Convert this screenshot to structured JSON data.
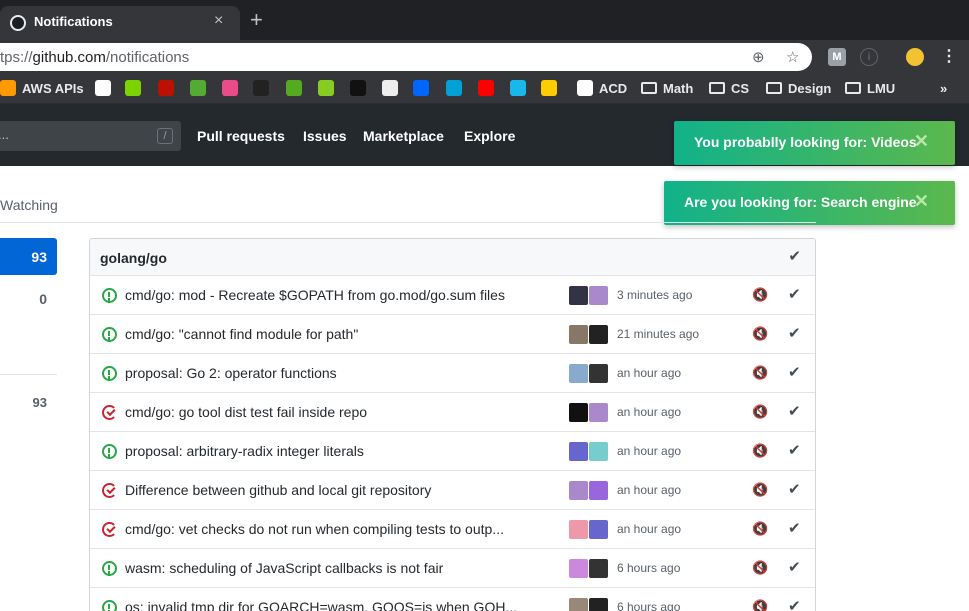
{
  "browser": {
    "tab_title": "Notifications",
    "url_prefix": "tps://",
    "url_host": "github.com",
    "url_path": "/notifications",
    "new_tab": "+",
    "close_tab": "×"
  },
  "bookmarks": [
    {
      "label": "AWS APIs",
      "icon": "aws-icon"
    },
    {
      "label": "",
      "icon": "leetcode-icon"
    },
    {
      "label": "",
      "icon": "smiley-icon"
    },
    {
      "label": "",
      "icon": "as-icon"
    },
    {
      "label": "",
      "icon": "ol-icon"
    },
    {
      "label": "",
      "icon": "dribbble-icon"
    },
    {
      "label": "",
      "icon": "github-dark-icon"
    },
    {
      "label": "",
      "icon": "lmu-icon"
    },
    {
      "label": "",
      "icon": "x-icon"
    },
    {
      "label": "",
      "icon": "q-icon"
    },
    {
      "label": "",
      "icon": "b-icon"
    },
    {
      "label": "",
      "icon": "zhihu-icon"
    },
    {
      "label": "",
      "icon": "bilibili-icon"
    },
    {
      "label": "",
      "icon": "youtube-icon"
    },
    {
      "label": "",
      "icon": "vimeo-icon"
    },
    {
      "label": "",
      "icon": "avatar-icon"
    },
    {
      "label": "ACD",
      "icon": "doc-icon"
    },
    {
      "label": "Math",
      "icon": "folder-icon"
    },
    {
      "label": "CS",
      "icon": "folder-icon"
    },
    {
      "label": "Design",
      "icon": "folder-icon"
    },
    {
      "label": "LMU",
      "icon": "folder-icon"
    }
  ],
  "bookmarks_overflow": "»",
  "header": {
    "search_placeholder": "...",
    "slash_key": "/",
    "nav": [
      "Pull requests",
      "Issues",
      "Marketplace",
      "Explore"
    ]
  },
  "toasts": [
    {
      "message": "You probablly looking for: Videos",
      "close": "✕"
    },
    {
      "message": "Are you looking for: Search engine",
      "close": "✕"
    }
  ],
  "filters": {
    "watching_label": "Watching",
    "unread_count": "93",
    "participating_count": "0",
    "repo_count": "93"
  },
  "repo": {
    "name": "golang/go",
    "mark_all": "✔",
    "notifications": [
      {
        "title": "cmd/go: mod - Recreate $GOPATH from go.mod/go.sum files",
        "time": "3 minutes ago",
        "state": "open"
      },
      {
        "title": "cmd/go: \"cannot find module for path\"",
        "time": "21 minutes ago",
        "state": "open"
      },
      {
        "title": "proposal: Go 2: operator functions",
        "time": "an hour ago",
        "state": "open"
      },
      {
        "title": "cmd/go: go tool dist test fail inside repo",
        "time": "an hour ago",
        "state": "closed"
      },
      {
        "title": "proposal: arbitrary-radix integer literals",
        "time": "an hour ago",
        "state": "open"
      },
      {
        "title": "Difference between github and local git repository",
        "time": "an hour ago",
        "state": "closed"
      },
      {
        "title": "cmd/go: vet checks do not run when compiling tests to outp...",
        "time": "an hour ago",
        "state": "closed"
      },
      {
        "title": "wasm: scheduling of JavaScript callbacks is not fair",
        "time": "6 hours ago",
        "state": "open"
      },
      {
        "title": "os: invalid tmp dir for GOARCH=wasm, GOOS=js when GOH...",
        "time": "6 hours ago",
        "state": "open"
      }
    ],
    "mute_glyph": "🔇",
    "done_glyph": "✔"
  },
  "colors": {
    "accent": "#0366d6",
    "open": "#28a745",
    "closed": "#cb2431",
    "toast_from": "#11b28a",
    "toast_to": "#5bb84d"
  }
}
